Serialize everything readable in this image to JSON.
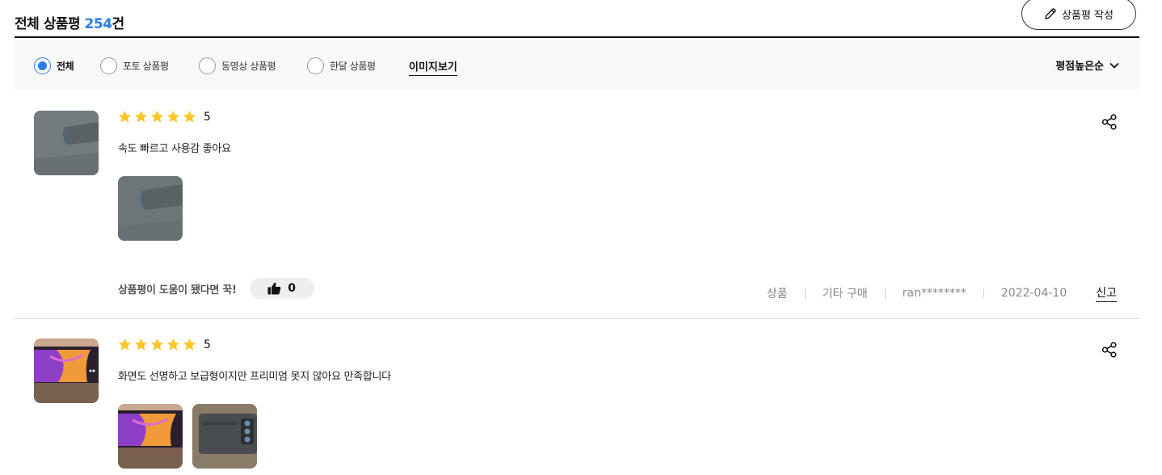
{
  "header": {
    "title_prefix": "전체 상품평 ",
    "count": "254",
    "title_suffix": "건",
    "write_button": "상품평 작성"
  },
  "filters": {
    "options": [
      "전체",
      "포토 상품평",
      "동영상 상품평",
      "한달 상품평"
    ],
    "selected": "전체",
    "image_view": "이미지보기",
    "sort_label": "평점높은순"
  },
  "reviews": [
    {
      "rating": 5,
      "rating_text": "5",
      "text": "속도 빠르고 사용감 좋아요",
      "helpful_text": "상품평이 도움이 됐다면 꾹!",
      "likes": "0",
      "option": "상품",
      "purchase_type": "기타 구매",
      "user": "ran********",
      "date": "2022-04-10",
      "report": "신고",
      "images": [
        "gray leather phone case"
      ]
    },
    {
      "rating": 5,
      "rating_text": "5",
      "text": "화면도 선명하고 보급형이지만 프리미엄 못지 않아요 만족합니다",
      "images": [
        "phone screen with purple-orange wallpaper",
        "dark gray phone back with camera"
      ]
    }
  ],
  "colors": {
    "accent": "#2b7de9",
    "star": "#ffc626",
    "filter_bg": "#f8f8f8"
  }
}
